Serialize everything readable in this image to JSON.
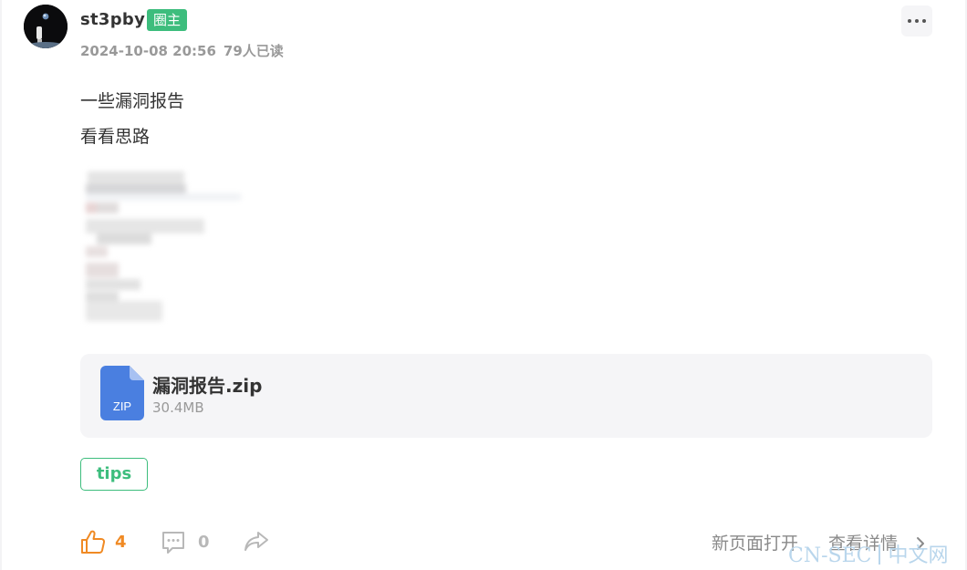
{
  "author": {
    "name": "st3pby",
    "badge": "圈主",
    "date": "2024-10-08 20:56",
    "reads": "79人已读"
  },
  "post": {
    "lines": [
      "一些漏洞报告",
      "看看思路"
    ]
  },
  "attachment": {
    "icon_label": "ZIP",
    "name": "漏洞报告.zip",
    "size": "30.4MB"
  },
  "tag": "tips",
  "actions": {
    "likes": "4",
    "comments": "0",
    "open_new": "新页面打开",
    "view_detail": "查看详情"
  },
  "watermark": {
    "left": "CN-SEC",
    "right": "中文网"
  },
  "colors": {
    "accent_green": "#3dbd7d",
    "like_orange": "#f08a24",
    "file_blue": "#4a7fe0"
  },
  "icons": [
    "more-icon",
    "zip-file-icon",
    "thumbs-up-icon",
    "comment-icon",
    "share-icon",
    "chevron-right-icon"
  ]
}
